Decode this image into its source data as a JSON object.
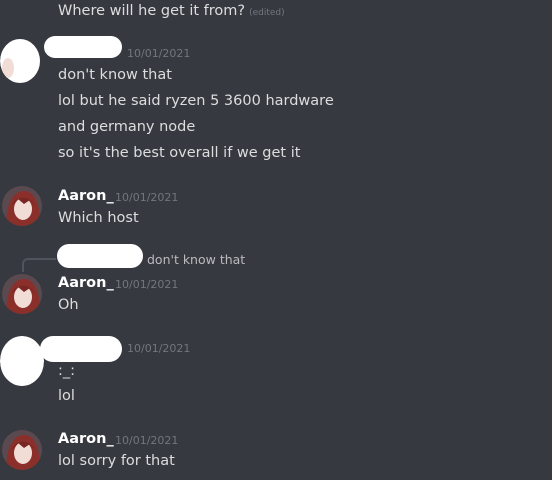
{
  "messages": {
    "m0": {
      "text": "Where will he get it from?",
      "edited": "(edited)"
    },
    "m1": {
      "timestamp": "10/01/2021",
      "lines": [
        "don't know that",
        "lol but he said ryzen 5 3600 hardware",
        "and germany node",
        "so it's the best overall if we get it"
      ]
    },
    "m2": {
      "author": "Aaron_",
      "timestamp": "10/01/2021",
      "text": "Which host"
    },
    "m3": {
      "reply_preview": "don't know that",
      "author": "Aaron_",
      "timestamp": "10/01/2021",
      "text": "Oh"
    },
    "m4": {
      "timestamp": "10/01/2021",
      "lines": [
        ":_:",
        "lol"
      ]
    },
    "m5": {
      "author": "Aaron_",
      "timestamp": "10/01/2021",
      "text": "lol sorry for that"
    }
  },
  "colors": {
    "background": "#36393f",
    "text": "#dcddde",
    "author": "#ffffff",
    "muted": "#72767d",
    "redaction": "#ffffff"
  }
}
